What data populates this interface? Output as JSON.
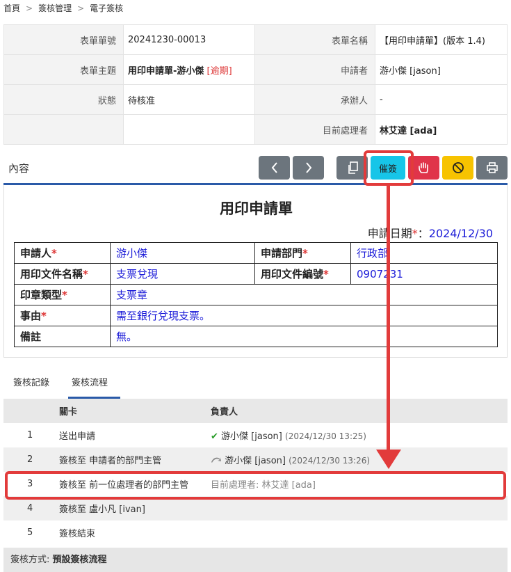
{
  "breadcrumb": {
    "home": "首頁",
    "section": "簽核管理",
    "page": "電子簽核"
  },
  "info": {
    "form_no_label": "表單單號",
    "form_no": "20241230-00013",
    "form_name_label": "表單名稱",
    "form_name": "【用印申請單】(版本 1.4)",
    "subject_label": "表單主題",
    "subject": "用印申請單-游小傑",
    "overdue": "[逾期]",
    "applicant_label": "申請者",
    "applicant": "游小傑 [jason]",
    "status_label": "狀態",
    "status": "待核准",
    "handler_label": "承辦人",
    "handler": "-",
    "current_label": "目前處理者",
    "current": "林艾達 [ada]"
  },
  "content_title": "內容",
  "toolbar": {
    "urge_label": "催簽",
    "prev_icon": "chevron-left-icon",
    "next_icon": "chevron-right-icon",
    "copy_icon": "copy-icon",
    "hand_icon": "hand-stop-icon",
    "cancel_icon": "ban-icon",
    "print_icon": "printer-icon"
  },
  "document": {
    "title": "用印申請單",
    "date_label": "申請日期",
    "date": "2024/12/30",
    "applicant_label": "申請人",
    "applicant": "游小傑",
    "dept_label": "申請部門",
    "dept": "行政部",
    "docname_label": "用印文件名稱",
    "docname": "支票兌現",
    "docno_label": "用印文件編號",
    "docno": "0907231",
    "seal_label": "印章類型",
    "seal": "支票章",
    "reason_label": "事由",
    "reason": "需至銀行兌現支票。",
    "note_label": "備註",
    "note": "無。",
    "required_mark": "*"
  },
  "tabs": {
    "records": "簽核記錄",
    "flow": "簽核流程"
  },
  "flow": {
    "header": {
      "stage": "關卡",
      "owner": "負責人"
    },
    "rows": [
      {
        "no": "1",
        "stage": "送出申請",
        "owner": "游小傑 [jason]",
        "time": "(2024/12/30 13:25)"
      },
      {
        "no": "2",
        "stage": "簽核至 申請者的部門主管",
        "owner": "游小傑 [jason]",
        "time": "(2024/12/30 13:26)"
      },
      {
        "no": "3",
        "stage": "簽核至 前一位處理者的部門主管",
        "owner": "目前處理者: 林艾達 [ada]"
      },
      {
        "no": "4",
        "stage": "簽核至 盧小凡 [ivan]"
      },
      {
        "no": "5",
        "stage": "簽核結束"
      }
    ]
  },
  "footer": {
    "label": "簽核方式:",
    "value": "預設簽核流程"
  },
  "colors": {
    "accent": "#2a5aa8",
    "highlight": "#e23b3b",
    "urge_button": "#17c5e8",
    "required": "#d33",
    "value_blue": "#1a1ad8"
  }
}
